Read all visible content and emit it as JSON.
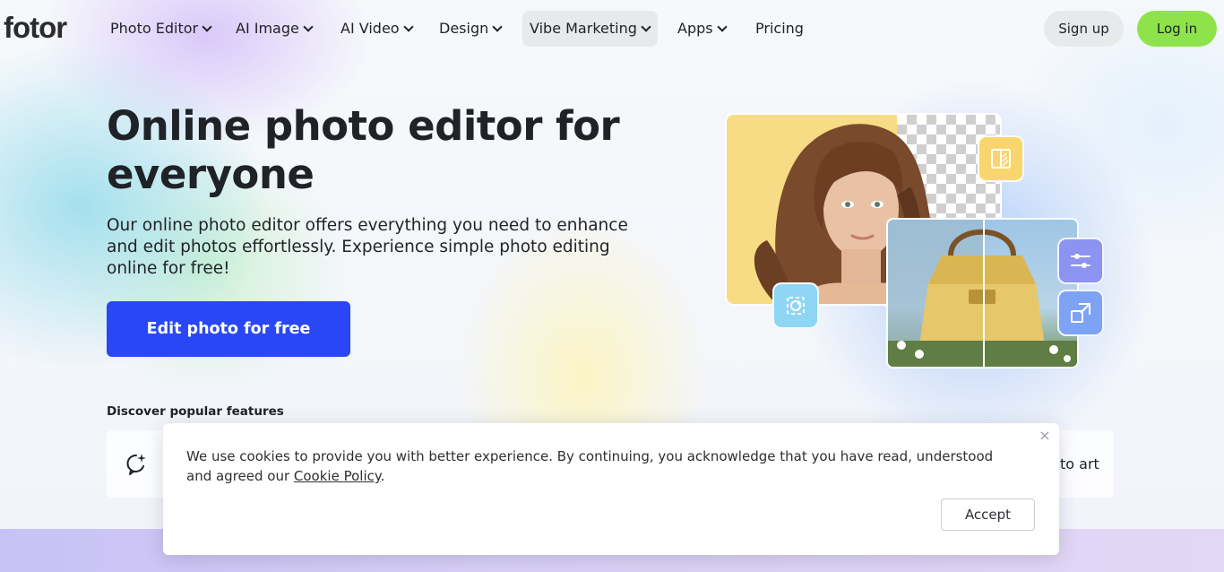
{
  "brand": {
    "logo_text": "fotor"
  },
  "nav": {
    "items": [
      {
        "label": "Photo Editor",
        "has_menu": true
      },
      {
        "label": "AI Image",
        "has_menu": true
      },
      {
        "label": "AI Video",
        "has_menu": true
      },
      {
        "label": "Design",
        "has_menu": true
      },
      {
        "label": "Vibe Marketing",
        "has_menu": true,
        "active": true
      },
      {
        "label": "Apps",
        "has_menu": true
      },
      {
        "label": "Pricing",
        "has_menu": false
      }
    ],
    "signup_label": "Sign up",
    "login_label": "Log in"
  },
  "hero": {
    "title": "Online photo editor for everyone",
    "description": "Our online photo editor offers everything you need to enhance and edit photos effortlessly. Experience simple photo editing online for free!",
    "cta_label": "Edit photo for free",
    "discover_label": "Discover popular features",
    "feature_visible_text": "to art"
  },
  "cookie": {
    "text_before_link": "We use cookies to provide you with better experience. By continuing, you acknowledge that you have read, understood and agreed our ",
    "link_text": "Cookie Policy",
    "text_after_link": ".",
    "accept_label": "Accept",
    "close_symbol": "×"
  },
  "colors": {
    "cta": "#2a47f5",
    "login": "#8ee34a",
    "signup": "#e8e9eb",
    "tool_yellow": "#f9d56e",
    "tool_blue": "#7ea3f5",
    "tool_sky": "#8fd6f5"
  },
  "icons": {
    "nav_chevron": "chevron-down-icon",
    "feature": "sparkle-chat-icon",
    "compare_tool": "compare-icon",
    "adjust_tool": "sliders-icon",
    "resize_tool": "resize-icon",
    "rotate_tool": "rotate-icon"
  }
}
